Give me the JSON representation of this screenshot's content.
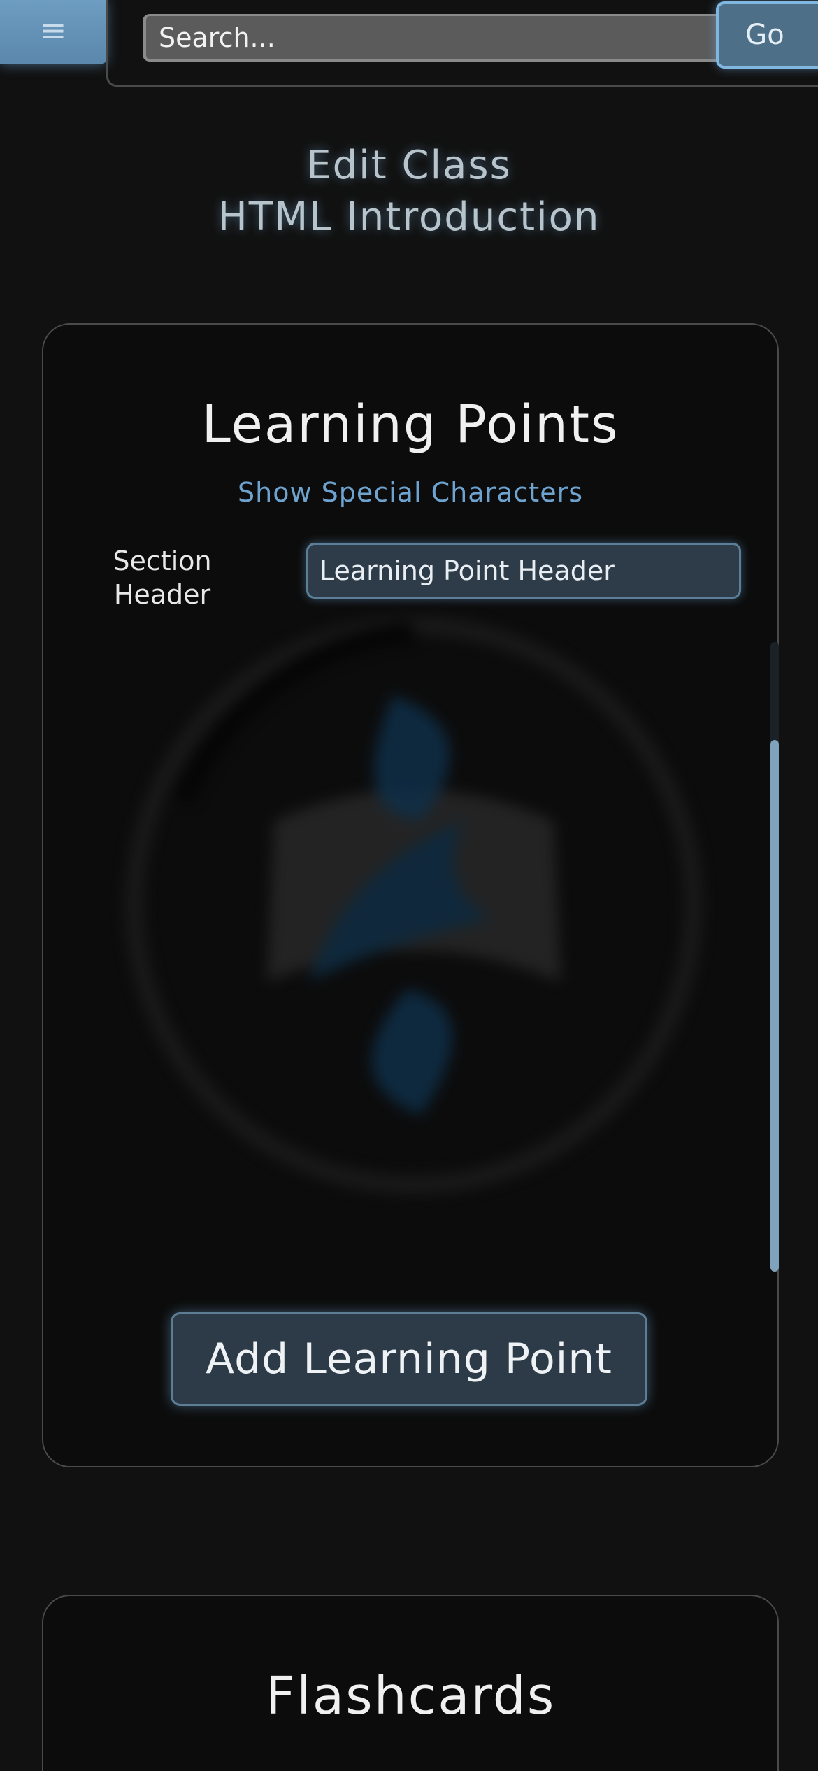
{
  "header": {
    "menu_icon": "hamburger-icon",
    "menu_glyph": "≡",
    "search_placeholder": "Search...",
    "go_label": "Go"
  },
  "page": {
    "heading_line1": "Edit Class",
    "heading_line2": "HTML Introduction"
  },
  "learning_points": {
    "title": "Learning Points",
    "special_chars_link": "Show Special Characters",
    "section_label": "Section Header",
    "section_placeholder": "Learning Point Header",
    "loading_icon": "loading-spinner-icon",
    "add_button_label": "Add Learning Point"
  },
  "flashcards": {
    "title": "Flashcards"
  },
  "colors": {
    "background": "#111111",
    "card": "#0c0c0c",
    "accent_blue": "#6ea3cf",
    "button_fill": "#2c3b47"
  }
}
